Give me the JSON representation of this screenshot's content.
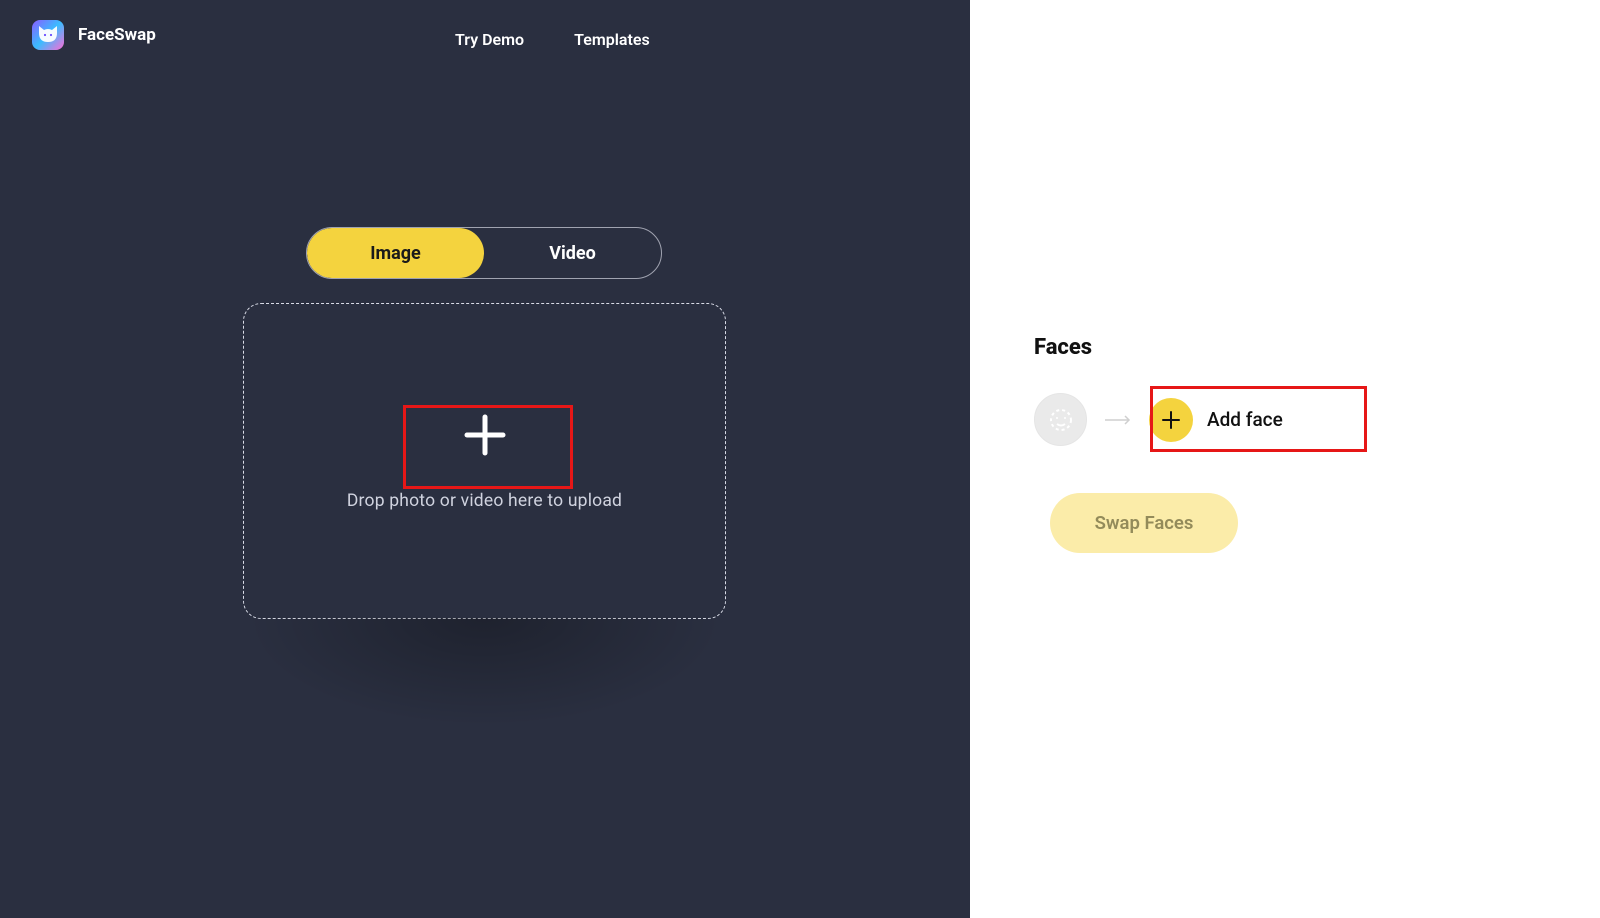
{
  "brand": {
    "name": "FaceSwap"
  },
  "nav": {
    "try_demo": "Try Demo",
    "templates": "Templates"
  },
  "toggle": {
    "image": "Image",
    "video": "Video"
  },
  "dropzone": {
    "hint": "Drop photo or video here to upload"
  },
  "faces": {
    "title": "Faces",
    "add_face": "Add face",
    "swap_button": "Swap Faces"
  }
}
